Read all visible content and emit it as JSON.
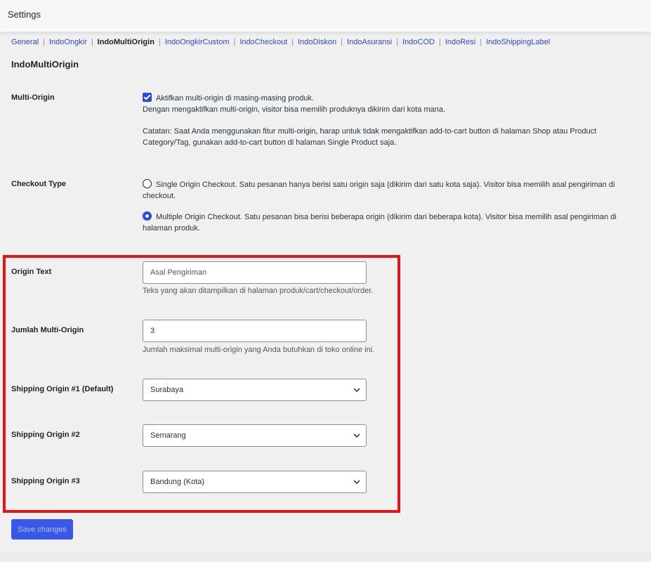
{
  "topbar": {
    "title": "Settings"
  },
  "subnav": {
    "items": [
      {
        "label": "General",
        "current": false
      },
      {
        "label": "IndoOngkir",
        "current": false
      },
      {
        "label": "IndoMultiOrigin",
        "current": true
      },
      {
        "label": "IndoOngkirCustom",
        "current": false
      },
      {
        "label": "IndoCheckout",
        "current": false
      },
      {
        "label": "IndoDiskon",
        "current": false
      },
      {
        "label": "IndoAsuransi",
        "current": false
      },
      {
        "label": "IndoCOD",
        "current": false
      },
      {
        "label": "IndoResi",
        "current": false
      },
      {
        "label": "IndoShippingLabel",
        "current": false
      }
    ],
    "separator": "|"
  },
  "page": {
    "heading": "IndoMultiOrigin"
  },
  "multi_origin": {
    "label": "Multi-Origin",
    "checkbox_label": "Aktifkan multi-origin di masing-masing produk.",
    "checked": true,
    "description": "Dengan mengaktifkan multi-origin, visitor bisa memilih produknya dikirim dari kota mana.",
    "note": "Catatan: Saat Anda menggunakan fitur multi-origin, harap untuk tidak mengaktifkan add-to-cart button di halaman Shop atau Product Category/Tag, gunakan add-to-cart button di halaman Single Product saja."
  },
  "checkout_type": {
    "label": "Checkout Type",
    "options": [
      {
        "label": "Single Origin Checkout. Satu pesanan hanya berisi satu origin saja (dikirim dari satu kota saja). Visitor bisa memilih asal pengiriman di checkout.",
        "selected": false
      },
      {
        "label": "Multiple Origin Checkout. Satu pesanan bisa berisi beberapa origin (dikirim dari beberapa kota). Visitor bisa memilih asal pengiriman di halaman produk.",
        "selected": true
      }
    ]
  },
  "origin_text": {
    "label": "Origin Text",
    "placeholder": "Asal Pengiriman",
    "value": "",
    "description": "Teks yang akan ditampilkan di halaman produk/cart/checkout/order."
  },
  "jumlah_multi_origin": {
    "label": "Jumlah Multi-Origin",
    "value": "3",
    "description": "Jumlah maksimal multi-origin yang Anda butuhkan di toko online ini."
  },
  "shipping_origins": [
    {
      "label": "Shipping Origin #1 (Default)",
      "value": "Surabaya"
    },
    {
      "label": "Shipping Origin #2",
      "value": "Semarang"
    },
    {
      "label": "Shipping Origin #3",
      "value": "Bandung (Kota)"
    }
  ],
  "save_button": {
    "label": "Save changes"
  },
  "colors": {
    "accent": "#2b48d6",
    "highlight_border": "#e0161b",
    "button_bg": "#3858e9"
  }
}
